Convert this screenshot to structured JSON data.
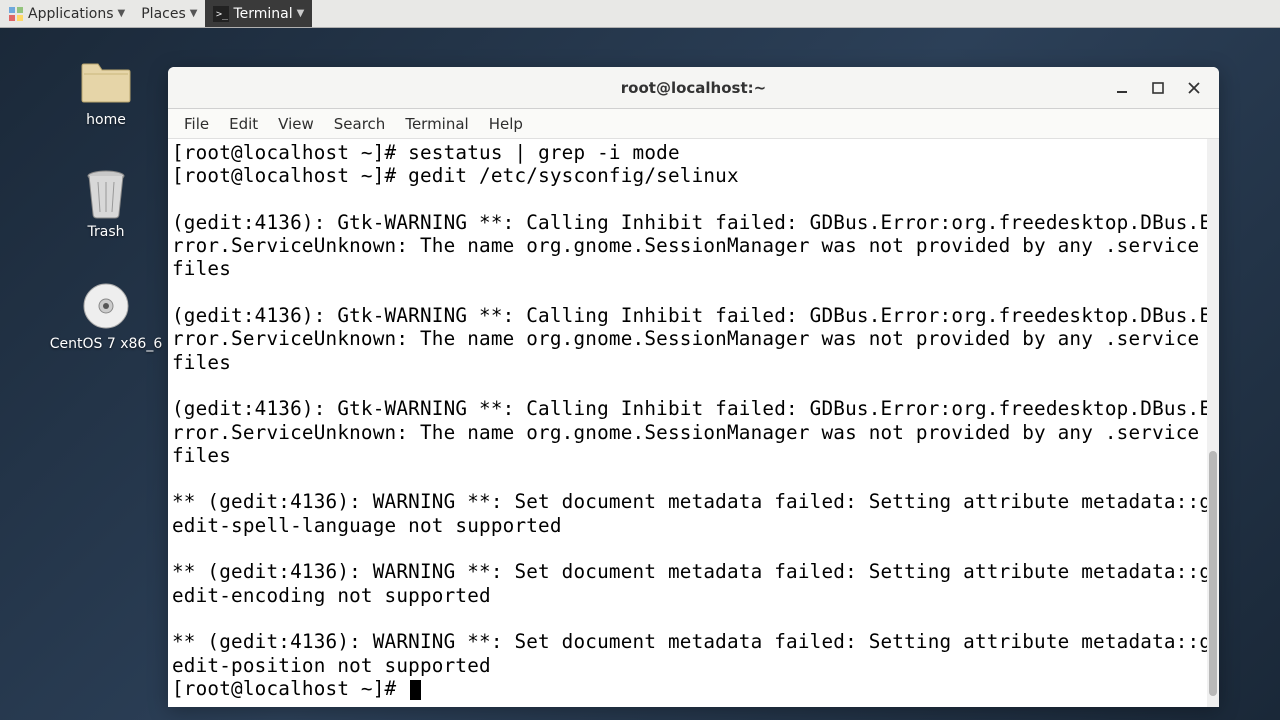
{
  "panel": {
    "applications": "Applications",
    "places": "Places",
    "terminal": "Terminal"
  },
  "desktop_icons": {
    "home": "home",
    "trash": "Trash",
    "cd": "CentOS 7 x86_6"
  },
  "window": {
    "title": "root@localhost:~",
    "menus": [
      "File",
      "Edit",
      "View",
      "Search",
      "Terminal",
      "Help"
    ]
  },
  "terminal": {
    "prompt": "[root@localhost ~]# ",
    "cmd1": "sestatus | grep -i mode",
    "cmd2": "gedit /etc/sysconfig/selinux",
    "gtk_warn": "(gedit:4136): Gtk-WARNING **: Calling Inhibit failed: GDBus.Error:org.freedesktop.DBus.Error.ServiceUnknown: The name org.gnome.SessionManager was not provided by any .service files",
    "meta_warn_prefix": "** (gedit:4136): WARNING **: Set document metadata failed: Setting attribute metadata::",
    "meta1": "gedit-spell-language not supported",
    "meta2": "gedit-encoding not supported",
    "meta3": "gedit-position not supported"
  }
}
